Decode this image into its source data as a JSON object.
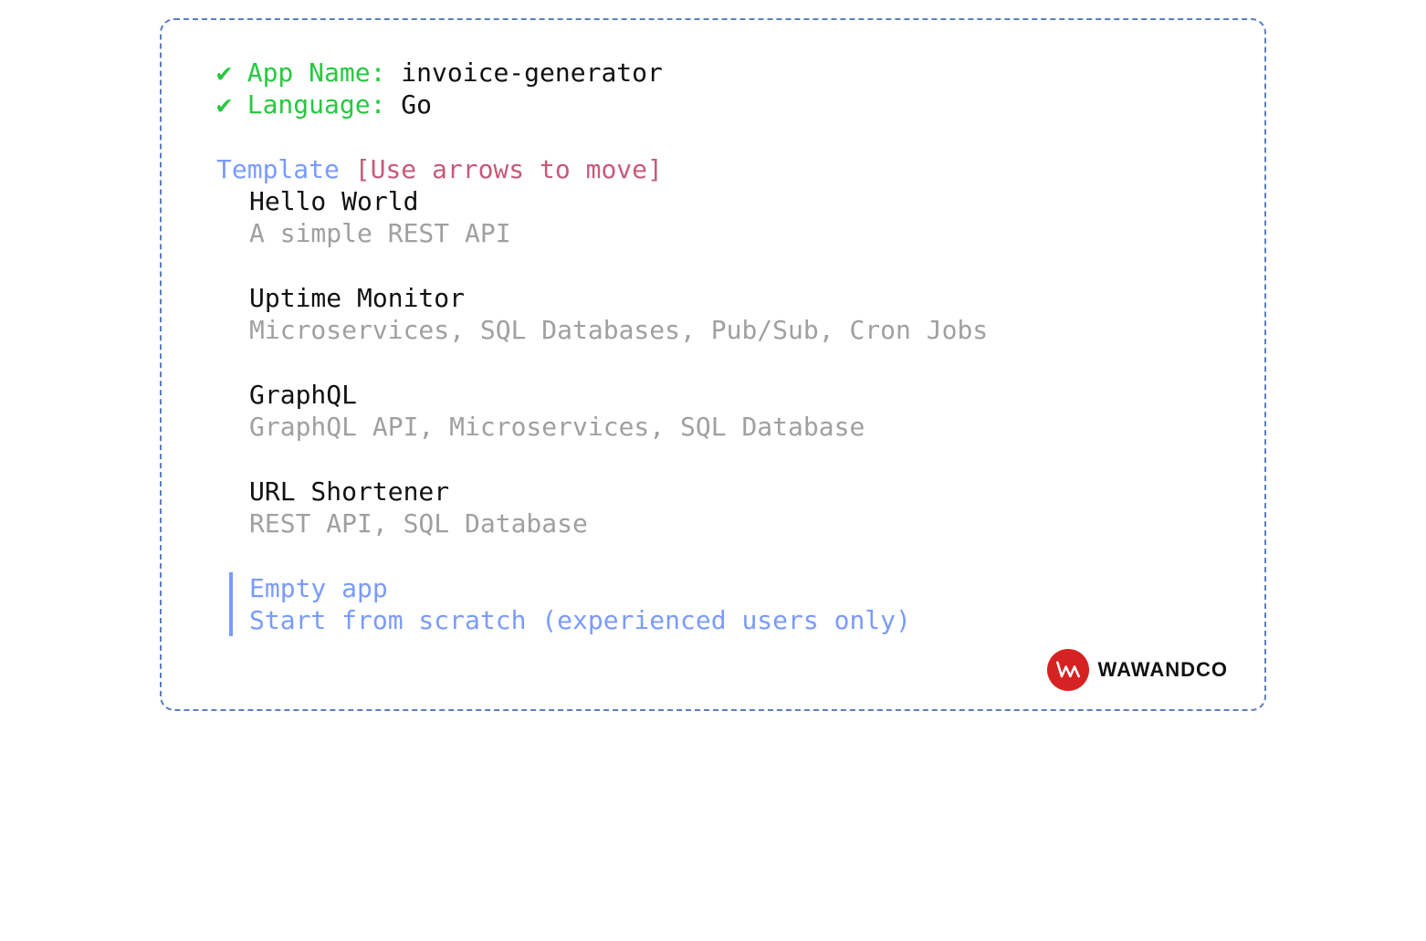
{
  "checkmark": "✔",
  "fields": {
    "appName": {
      "label": "App Name:",
      "value": "invoice-generator"
    },
    "language": {
      "label": "Language:",
      "value": "Go"
    }
  },
  "template": {
    "label": "Template",
    "hint": "[Use arrows to move]",
    "options": [
      {
        "title": "Hello World",
        "desc": "A simple REST API"
      },
      {
        "title": "Uptime Monitor",
        "desc": "Microservices, SQL Databases, Pub/Sub, Cron Jobs"
      },
      {
        "title": "GraphQL",
        "desc": "GraphQL API, Microservices, SQL Database"
      },
      {
        "title": "URL Shortener",
        "desc": "REST API, SQL Database"
      }
    ],
    "selected": {
      "title": "Empty app",
      "desc": "Start from scratch (experienced users only)"
    }
  },
  "brand": {
    "name": "WAWANDCO"
  }
}
